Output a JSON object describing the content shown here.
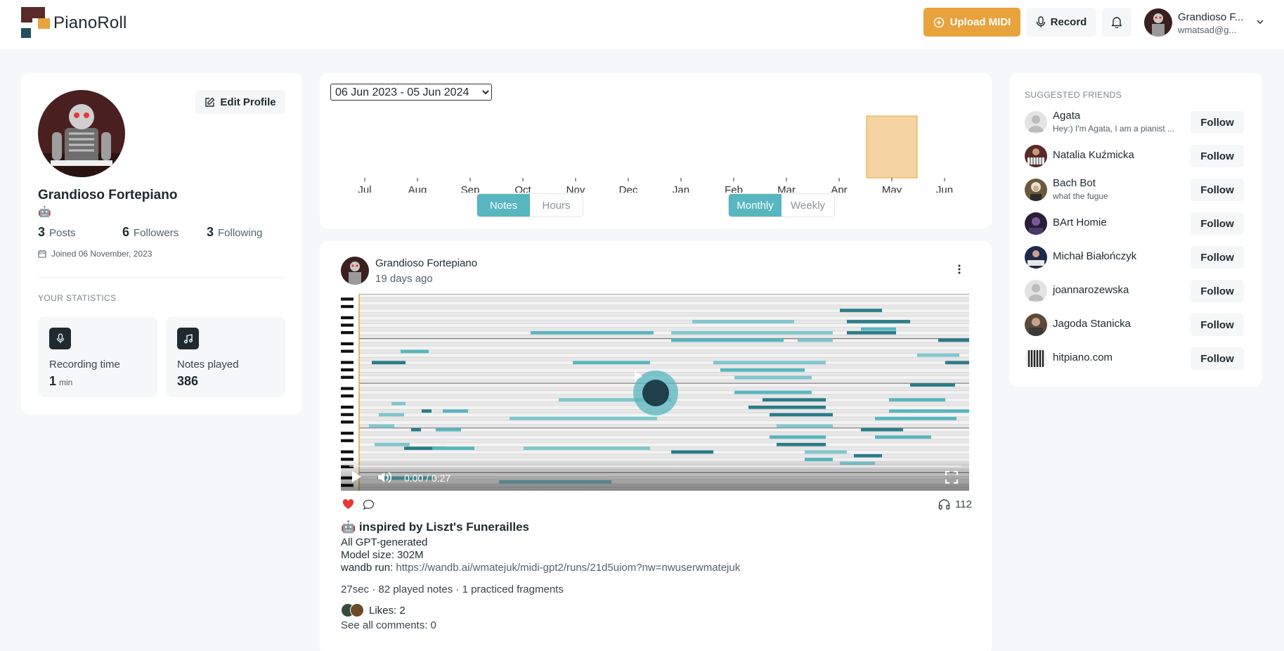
{
  "header": {
    "logo_text": "PianoRoll",
    "upload_label": "Upload MIDI",
    "record_label": "Record",
    "user_name": "Grandioso F...",
    "user_email": "wmatsad@g..."
  },
  "profile": {
    "edit_label": "Edit Profile",
    "name": "Grandioso Fortepiano",
    "emoji": "🤖",
    "posts_count": "3",
    "posts_label": "Posts",
    "followers_count": "6",
    "followers_label": "Followers",
    "following_count": "3",
    "following_label": "Following",
    "joined": "Joined 06 November, 2023",
    "stats_title": "YOUR STATISTICS",
    "recording_label": "Recording time",
    "recording_value": "1",
    "recording_unit": "min",
    "notes_label": "Notes played",
    "notes_value": "386"
  },
  "chart_controls": {
    "date_range": "06 Jun 2023 - 05 Jun 2024",
    "metric_tabs": [
      "Notes",
      "Hours"
    ],
    "metric_active": "Notes",
    "period_tabs": [
      "Monthly",
      "Weekly"
    ],
    "period_active": "Monthly"
  },
  "chart_data": {
    "type": "bar",
    "categories": [
      "Jul",
      "Aug",
      "Sep",
      "Oct",
      "Nov",
      "Dec",
      "Jan",
      "Feb",
      "Mar",
      "Apr",
      "May",
      "Jun"
    ],
    "values": [
      0,
      0,
      0,
      0,
      0,
      0,
      0,
      0,
      0,
      0,
      386,
      0
    ],
    "ylim": [
      0,
      386
    ],
    "grid": false,
    "bar_color": "#f6d3a3",
    "bar_border": "#e8a33c"
  },
  "post": {
    "author": "Grandioso Fortepiano",
    "time": "19 days ago",
    "time_display": "0:00 / 0:27",
    "listens": "112",
    "title": "🤖 inspired by Liszt's Funerailles",
    "line1": "All GPT-generated",
    "line2": "Model size: 302M",
    "line3_label": "wandb run:",
    "line3_link": "https://wandb.ai/wmatejuk/midi-gpt2/runs/21d5uiom?nw=nwuserwmatejuk",
    "meta": "27sec · 82 played notes · 1 practiced fragments",
    "likes": "Likes: 2",
    "comments": "See all comments: 0"
  },
  "friends": {
    "title": "SUGGESTED FRIENDS",
    "follow_label": "Follow",
    "items": [
      {
        "name": "Agata",
        "bio": "Hey:) I'm Agata, I am a pianist ..."
      },
      {
        "name": "Natalia Kuźmicka",
        "bio": ""
      },
      {
        "name": "Bach Bot",
        "bio": "what the fugue"
      },
      {
        "name": "BArt Homie",
        "bio": ""
      },
      {
        "name": "Michał Białończyk",
        "bio": ""
      },
      {
        "name": "joannarozewska",
        "bio": ""
      },
      {
        "name": "Jagoda Stanicka",
        "bio": ""
      },
      {
        "name": "hitpiano.com",
        "bio": ""
      }
    ]
  },
  "colors": {
    "accent": "#e8a33c",
    "teal": "#57b6bf",
    "dark_teal": "#2a7c88",
    "heart": "#e53935"
  }
}
